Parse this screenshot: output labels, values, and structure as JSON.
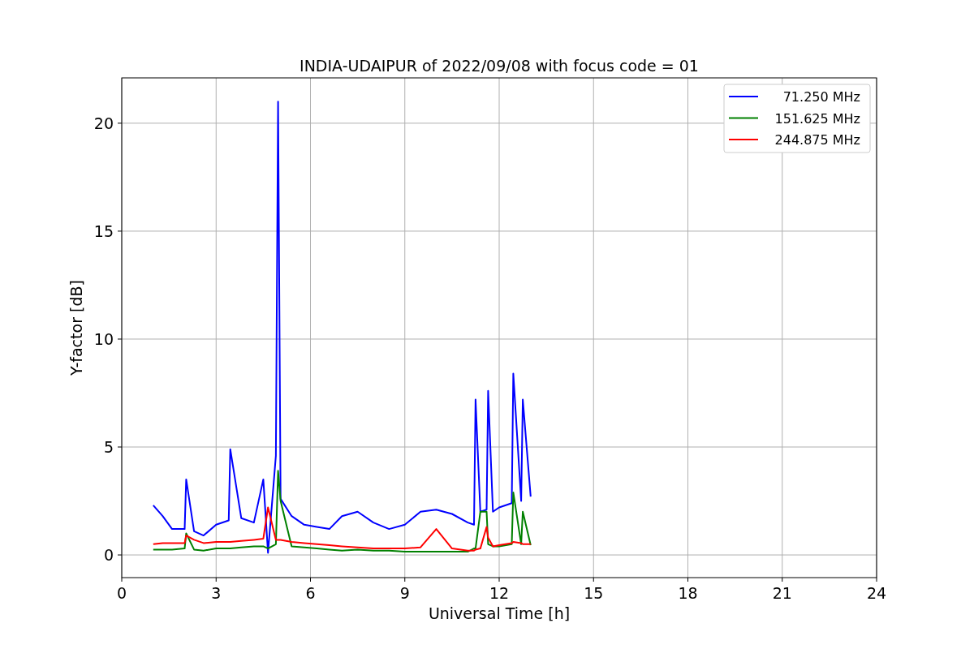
{
  "figure": {
    "chart_data": {
      "type": "line",
      "title": "INDIA-UDAIPUR of 2022/09/08 with focus code = 01",
      "xlabel": "Universal Time [h]",
      "ylabel": "Y-factor [dB]",
      "x": [
        1.0,
        1.3,
        1.6,
        2.0,
        2.05,
        2.3,
        2.6,
        3.0,
        3.4,
        3.45,
        3.8,
        4.2,
        4.5,
        4.65,
        4.9,
        4.97,
        5.05,
        5.4,
        5.8,
        6.2,
        6.6,
        7.0,
        7.5,
        8.0,
        8.5,
        9.0,
        9.5,
        10.0,
        10.5,
        11.0,
        11.2,
        11.25,
        11.4,
        11.6,
        11.65,
        11.8,
        12.0,
        12.4,
        12.45,
        12.7,
        12.75,
        13.0
      ],
      "series": [
        {
          "name": "71.250 MHz",
          "color": "#0000ff",
          "values": [
            2.3,
            1.8,
            1.2,
            1.2,
            3.5,
            1.1,
            0.9,
            1.4,
            1.6,
            4.9,
            1.7,
            1.5,
            3.5,
            0.1,
            4.6,
            21.0,
            2.6,
            1.8,
            1.4,
            1.3,
            1.2,
            1.8,
            2.0,
            1.5,
            1.2,
            1.4,
            2.0,
            2.1,
            1.9,
            1.5,
            1.4,
            7.2,
            2.0,
            2.1,
            7.6,
            2.0,
            2.2,
            2.4,
            8.4,
            2.5,
            7.2,
            2.7
          ]
        },
        {
          "name": "151.625 MHz",
          "color": "#008000",
          "values": [
            0.25,
            0.25,
            0.25,
            0.3,
            1.0,
            0.25,
            0.2,
            0.3,
            0.3,
            0.3,
            0.35,
            0.4,
            0.4,
            0.3,
            0.5,
            3.9,
            2.5,
            0.4,
            0.35,
            0.3,
            0.25,
            0.2,
            0.25,
            0.2,
            0.2,
            0.15,
            0.15,
            0.15,
            0.15,
            0.15,
            0.3,
            0.3,
            2.0,
            2.0,
            0.5,
            0.4,
            0.4,
            0.5,
            2.9,
            0.5,
            2.0,
            0.45
          ]
        },
        {
          "name": "244.875 MHz",
          "color": "#ff0000",
          "values": [
            0.5,
            0.55,
            0.55,
            0.55,
            0.9,
            0.7,
            0.55,
            0.6,
            0.6,
            0.6,
            0.65,
            0.7,
            0.75,
            2.2,
            0.7,
            0.7,
            0.7,
            0.6,
            0.55,
            0.5,
            0.45,
            0.4,
            0.35,
            0.3,
            0.3,
            0.3,
            0.35,
            1.2,
            0.3,
            0.2,
            0.2,
            0.25,
            0.3,
            1.3,
            0.8,
            0.4,
            0.45,
            0.55,
            0.6,
            0.55,
            0.5,
            0.5
          ]
        }
      ],
      "xlim": [
        0,
        24
      ],
      "ylim": [
        -1.05,
        22.1
      ],
      "xticks": [
        0,
        3,
        6,
        9,
        12,
        15,
        18,
        21,
        24
      ],
      "yticks": [
        0,
        5,
        10,
        15,
        20
      ],
      "grid": true,
      "legend": true
    }
  }
}
